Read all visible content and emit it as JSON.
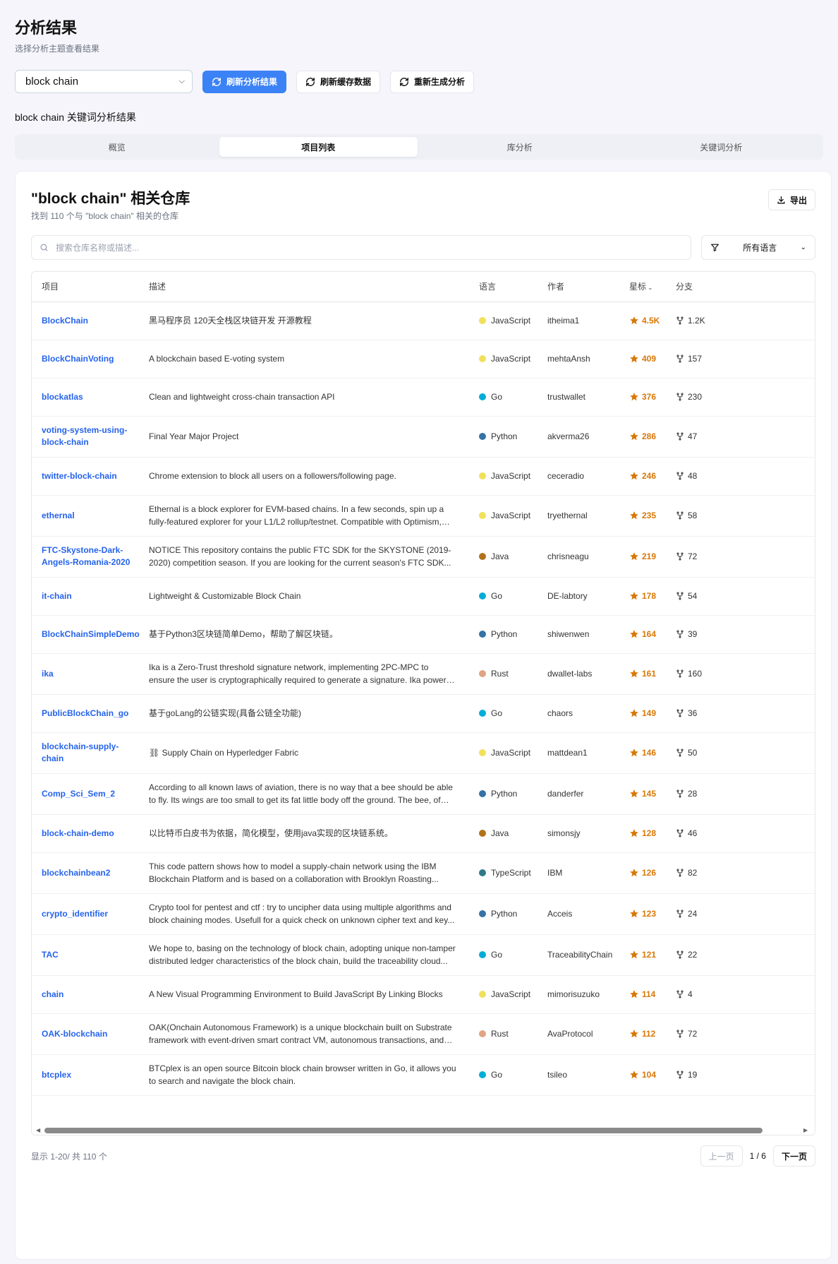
{
  "header": {
    "title": "分析结果",
    "subtitle": "选择分析主题查看结果"
  },
  "controls": {
    "topic_value": "block chain",
    "refresh_analysis": "刷新分析结果",
    "refresh_cache": "刷新缓存数据",
    "regenerate": "重新生成分析"
  },
  "section_label": "block chain 关键词分析结果",
  "tabs": [
    {
      "label": "概览"
    },
    {
      "label": "项目列表"
    },
    {
      "label": "库分析"
    },
    {
      "label": "关键词分析"
    }
  ],
  "card": {
    "title": "\"block chain\" 相关仓库",
    "subtitle": "找到 110 个与 \"block chain\" 相关的仓库",
    "export_label": "导出",
    "search_placeholder": "搜索仓库名称或描述...",
    "language_filter": "所有语言"
  },
  "table": {
    "headers": {
      "name": "项目",
      "desc": "描述",
      "lang": "语言",
      "author": "作者",
      "stars": "星标",
      "forks": "分支"
    },
    "rows": [
      {
        "name": "BlockChain",
        "desc": "黑马程序员 120天全栈区块链开发 开源教程",
        "lang": "JavaScript",
        "lang_color": "#f1e05a",
        "author": "itheima1",
        "stars": "4.5K",
        "forks": "1.2K"
      },
      {
        "name": "BlockChainVoting",
        "desc": "A blockchain based E-voting system",
        "lang": "JavaScript",
        "lang_color": "#f1e05a",
        "author": "mehtaAnsh",
        "stars": "409",
        "forks": "157"
      },
      {
        "name": "blockatlas",
        "desc": "Clean and lightweight cross-chain transaction API",
        "lang": "Go",
        "lang_color": "#00add8",
        "author": "trustwallet",
        "stars": "376",
        "forks": "230"
      },
      {
        "name": "voting-system-using-block-chain",
        "desc": "Final Year Major Project",
        "lang": "Python",
        "lang_color": "#3572a5",
        "author": "akverma26",
        "stars": "286",
        "forks": "47"
      },
      {
        "name": "twitter-block-chain",
        "desc": "Chrome extension to block all users on a followers/following page.",
        "lang": "JavaScript",
        "lang_color": "#f1e05a",
        "author": "ceceradio",
        "stars": "246",
        "forks": "48"
      },
      {
        "name": "ethernal",
        "desc": "Ethernal is a block explorer for EVM-based chains. In a few seconds, spin up a fully-featured explorer for your L1/L2 rollup/testnet. Compatible with Optimism, ZK, Anvil...",
        "lang": "JavaScript",
        "lang_color": "#f1e05a",
        "author": "tryethernal",
        "stars": "235",
        "forks": "58"
      },
      {
        "name": "FTC-Skystone-Dark-Angels-Romania-2020",
        "desc": "NOTICE This repository contains the public FTC SDK for the SKYSTONE (2019-2020) competition season. If you are looking for the current season's FTC SDK...",
        "lang": "Java",
        "lang_color": "#b07219",
        "author": "chrisneagu",
        "stars": "219",
        "forks": "72"
      },
      {
        "name": "it-chain",
        "desc": "Lightweight & Customizable Block Chain",
        "lang": "Go",
        "lang_color": "#00add8",
        "author": "DE-labtory",
        "stars": "178",
        "forks": "54"
      },
      {
        "name": "BlockChainSimpleDemo",
        "desc": "基于Python3区块链简单Demo，帮助了解区块链。",
        "lang": "Python",
        "lang_color": "#3572a5",
        "author": "shiwenwen",
        "stars": "164",
        "forks": "39"
      },
      {
        "name": "ika",
        "desc": "Ika is a Zero-Trust threshold signature network, implementing 2PC-MPC to ensure the user is cryptographically required to generate a signature. Ika powers the...",
        "lang": "Rust",
        "lang_color": "#dea584",
        "author": "dwallet-labs",
        "stars": "161",
        "forks": "160"
      },
      {
        "name": "PublicBlockChain_go",
        "desc": "基于goLang的公链实现(具备公链全功能)",
        "lang": "Go",
        "lang_color": "#00add8",
        "author": "chaors",
        "stars": "149",
        "forks": "36"
      },
      {
        "name": "blockchain-supply-chain",
        "desc": "⛓ Supply Chain on Hyperledger Fabric",
        "lang": "JavaScript",
        "lang_color": "#f1e05a",
        "author": "mattdean1",
        "stars": "146",
        "forks": "50"
      },
      {
        "name": "Comp_Sci_Sem_2",
        "desc": "According to all known laws of aviation, there is no way that a bee should be able to fly. Its wings are too small to get its fat little body off the ground. The bee, of cours...",
        "lang": "Python",
        "lang_color": "#3572a5",
        "author": "danderfer",
        "stars": "145",
        "forks": "28"
      },
      {
        "name": "block-chain-demo",
        "desc": "以比特币白皮书为依据，简化模型，使用java实现的区块链系统。",
        "lang": "Java",
        "lang_color": "#b07219",
        "author": "simonsjy",
        "stars": "128",
        "forks": "46"
      },
      {
        "name": "blockchainbean2",
        "desc": "This code pattern shows how to model a supply-chain network using the IBM Blockchain Platform and is based on a collaboration with Brooklyn Roasting...",
        "lang": "TypeScript",
        "lang_color": "#31788a",
        "author": "IBM",
        "stars": "126",
        "forks": "82"
      },
      {
        "name": "crypto_identifier",
        "desc": "Crypto tool for pentest and ctf : try to uncipher data using multiple algorithms and block chaining modes. Usefull for a quick check on unknown cipher text and key...",
        "lang": "Python",
        "lang_color": "#3572a5",
        "author": "Acceis",
        "stars": "123",
        "forks": "24"
      },
      {
        "name": "TAC",
        "desc": "We hope to, basing on the technology of block chain, adopting unique non-tamper distributed ledger characteristics of the block chain, build the traceability cloud...",
        "lang": "Go",
        "lang_color": "#00add8",
        "author": "TraceabilityChain",
        "stars": "121",
        "forks": "22"
      },
      {
        "name": "chain",
        "desc": "A New Visual Programming Environment to Build JavaScript By Linking Blocks",
        "lang": "JavaScript",
        "lang_color": "#f1e05a",
        "author": "mimorisuzuko",
        "stars": "114",
        "forks": "4"
      },
      {
        "name": "OAK-blockchain",
        "desc": "OAK(Onchain Autonomous Framework) is a unique blockchain built on Substrate framework with event-driven smart contract VM, autonomous transactions, and on...",
        "lang": "Rust",
        "lang_color": "#dea584",
        "author": "AvaProtocol",
        "stars": "112",
        "forks": "72"
      },
      {
        "name": "btcplex",
        "desc": "BTCplex is an open source Bitcoin block chain browser written in Go, it allows you to search and navigate the block chain.",
        "lang": "Go",
        "lang_color": "#00add8",
        "author": "tsileo",
        "stars": "104",
        "forks": "19"
      }
    ]
  },
  "pagination": {
    "info": "显示 1-20/ 共 110 个",
    "prev": "上一页",
    "page": "1 / 6",
    "next": "下一页"
  },
  "colors": {
    "accent": "#3b82f6",
    "link": "#2563eb",
    "star": "#d97706"
  }
}
